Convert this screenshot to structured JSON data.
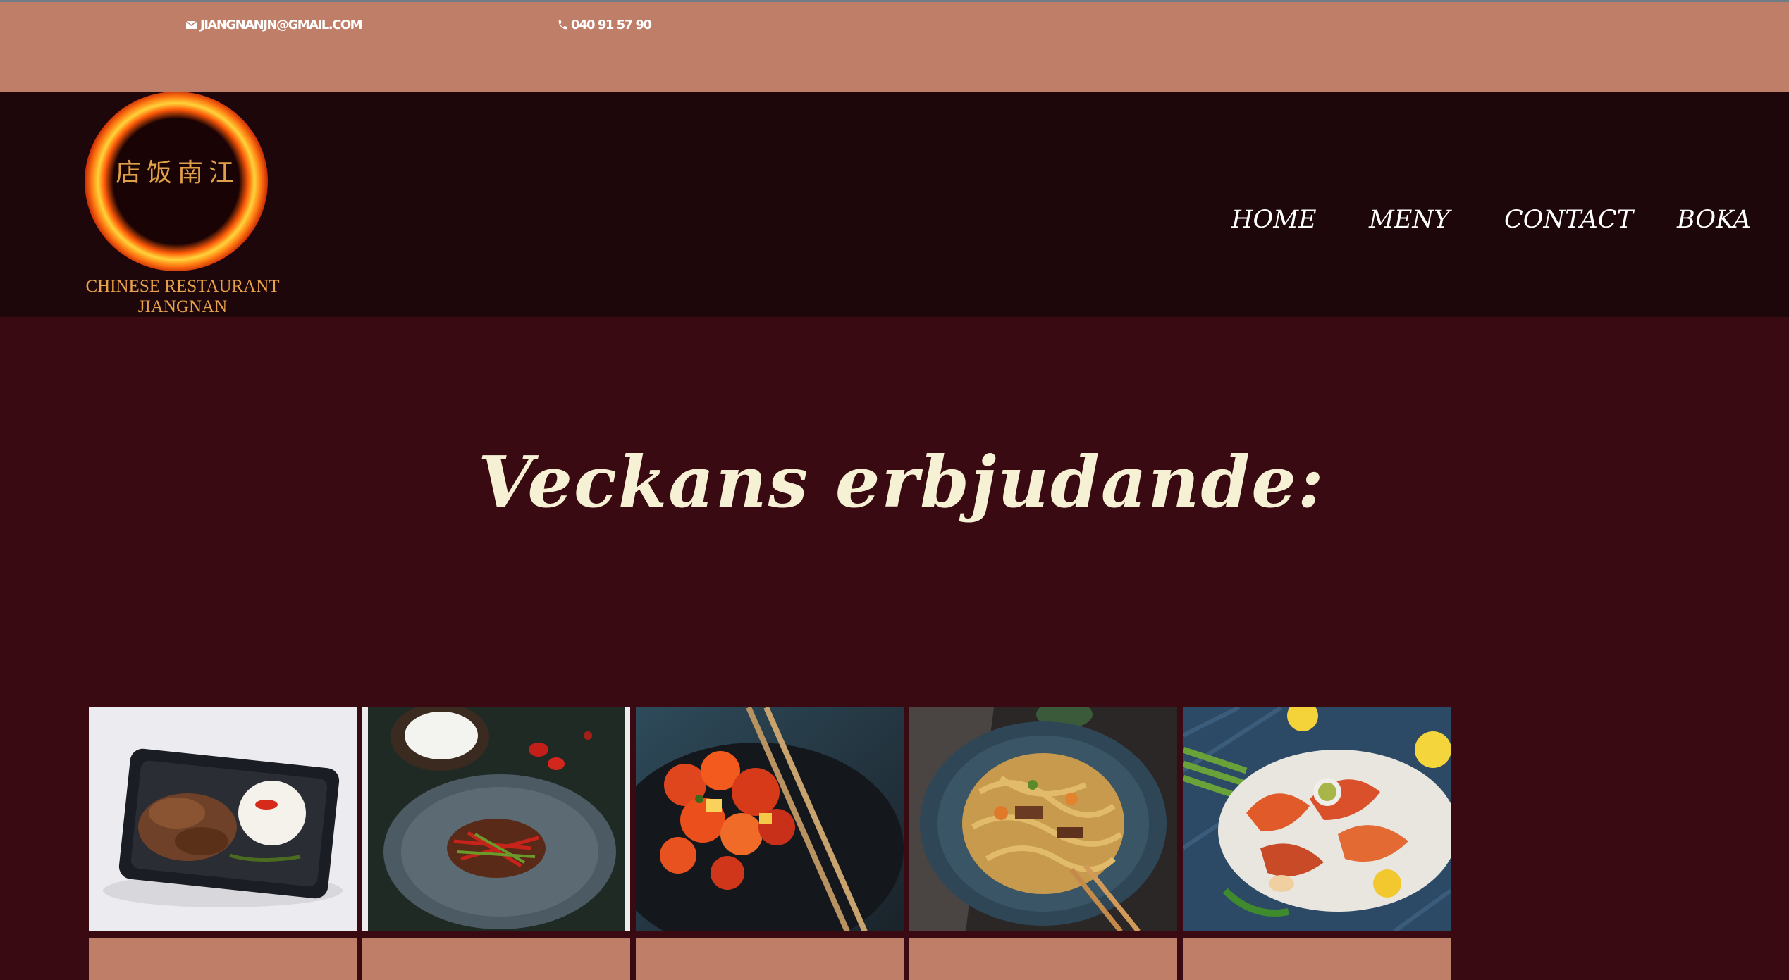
{
  "contact": {
    "email": "JIANGNANJN@GMAIL.COM",
    "email_icon": "envelope-icon",
    "phone": "040 91 57 90",
    "phone_icon": "phone-icon"
  },
  "logo": {
    "chinese_name": "店饭南江",
    "text_line1": "CHINESE RESTAURANT",
    "text_line2": "JIANGNAN"
  },
  "nav": {
    "items": [
      {
        "label": "HOME"
      },
      {
        "label": "MENY"
      },
      {
        "label": "CONTACT"
      },
      {
        "label": "BOKA"
      }
    ]
  },
  "hero": {
    "title": "Veckans erbjudande:"
  },
  "offers": {
    "items": [
      {
        "image": "duck-rice-dish",
        "caption": ""
      },
      {
        "image": "beef-stir-fry-dish",
        "caption": ""
      },
      {
        "image": "sweet-sour-pork-dish",
        "caption": ""
      },
      {
        "image": "udon-noodles-dish",
        "caption": ""
      },
      {
        "image": "seafood-platter-dish",
        "caption": ""
      }
    ]
  },
  "colors": {
    "top_bar": "#bf7e68",
    "header": "#1d070a",
    "page": "#3a0a12",
    "title": "#f6f1d5",
    "logo_text": "#e8a24a"
  }
}
